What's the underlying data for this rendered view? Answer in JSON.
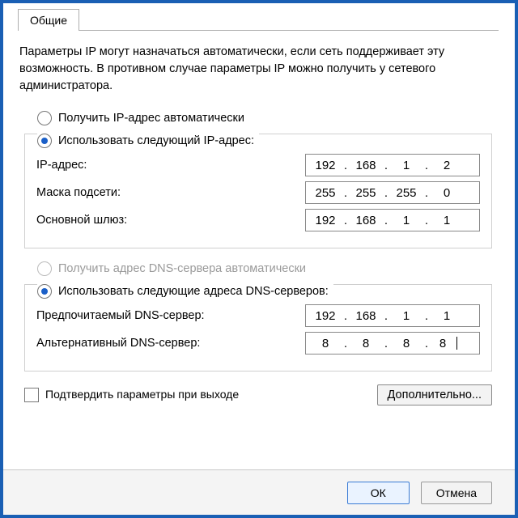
{
  "tab": {
    "label": "Общие"
  },
  "description": "Параметры IP могут назначаться автоматически, если сеть поддерживает эту возможность. В противном случае параметры IP можно получить у сетевого администратора.",
  "ip_section": {
    "auto_label": "Получить IP-адрес автоматически",
    "manual_label": "Использовать следующий IP-адрес:",
    "mode": "manual",
    "fields": {
      "ip_label": "IP-адрес:",
      "ip": [
        "192",
        "168",
        "1",
        "2"
      ],
      "mask_label": "Маска подсети:",
      "mask": [
        "255",
        "255",
        "255",
        "0"
      ],
      "gateway_label": "Основной шлюз:",
      "gateway": [
        "192",
        "168",
        "1",
        "1"
      ]
    }
  },
  "dns_section": {
    "auto_label": "Получить адрес DNS-сервера автоматически",
    "auto_enabled": false,
    "manual_label": "Использовать следующие адреса DNS-серверов:",
    "mode": "manual",
    "fields": {
      "preferred_label": "Предпочитаемый DNS-сервер:",
      "preferred": [
        "192",
        "168",
        "1",
        "1"
      ],
      "alternate_label": "Альтернативный DNS-сервер:",
      "alternate": [
        "8",
        "8",
        "8",
        "8"
      ]
    }
  },
  "confirm_label": "Подтвердить параметры при выходе",
  "advanced_label": "Дополнительно...",
  "buttons": {
    "ok": "ОК",
    "cancel": "Отмена"
  }
}
